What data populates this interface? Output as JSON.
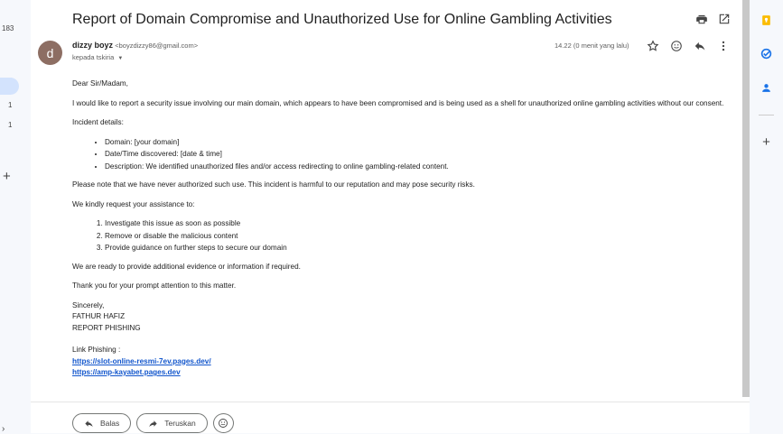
{
  "left_rail": {
    "counts": [
      "183",
      "1",
      "1"
    ],
    "plus": "+",
    "chevron": "›"
  },
  "email": {
    "subject": "Report of Domain Compromise and Unauthorized Use for Online Gambling Activities",
    "avatar_letter": "d",
    "sender_name": "dizzy boyz",
    "sender_email": "<boyzdizzy86@gmail.com>",
    "recipient": "kepada tskiria",
    "timestamp": "14.22 (0 menit yang lalu)",
    "body": {
      "greeting": "Dear Sir/Madam,",
      "intro": "I would like to report a security issue involving our main domain, which appears to have been compromised and is being used as a shell for unauthorized online gambling activities without our consent.",
      "details_heading": "Incident details:",
      "details": [
        "Domain: [your domain]",
        "Date/Time discovered: [date & time]",
        "Description: We identified unauthorized files and/or access redirecting to online gambling-related content."
      ],
      "note": "Please note that we have never authorized such use. This incident is harmful to our reputation and may pose security risks.",
      "request_heading": "We kindly request your assistance to:",
      "requests": [
        "Investigate this issue as soon as possible",
        "Remove or disable the malicious content",
        "Provide guidance on further steps to secure our domain"
      ],
      "ready": "We are ready to provide additional evidence or information if required.",
      "thanks": "Thank you for your prompt attention to this matter.",
      "closing": "Sincerely,",
      "name": "FATHUR HAFIZ",
      "title": "REPORT PHISHING",
      "links_label": "Link Phishing :",
      "links": [
        "https://slot-online-resmi-7ev.pages.dev/",
        "https://amp-kayabet.pages.dev"
      ]
    }
  },
  "actions": {
    "reply": "Balas",
    "forward": "Teruskan"
  },
  "colors": {
    "avatar": "#8d6e63",
    "link": "#1155cc",
    "keep": "#fbbc04",
    "tasks": "#1a73e8",
    "contacts": "#1a73e8"
  }
}
